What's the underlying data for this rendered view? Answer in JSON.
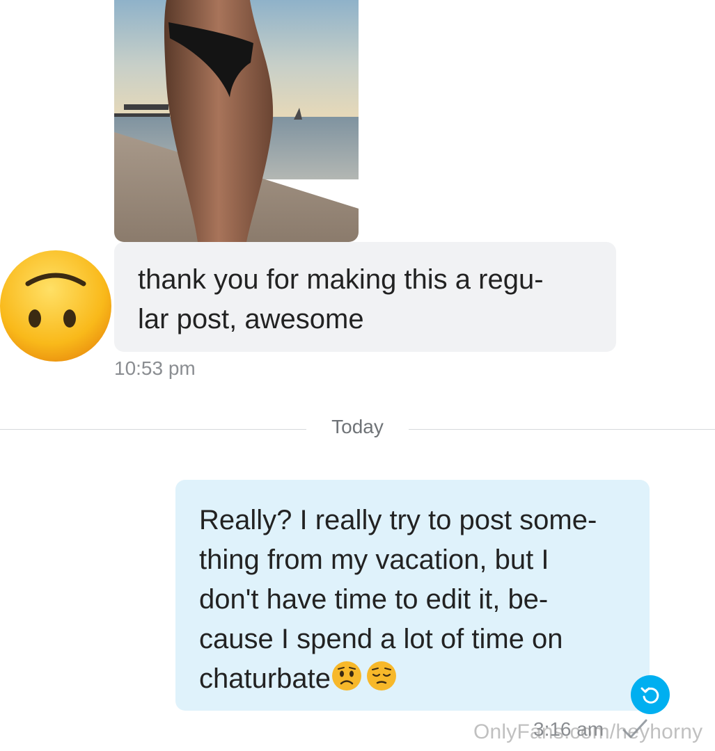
{
  "conversation": {
    "incoming": {
      "text_lines": [
        "thank you for making this a regu-",
        "lar post, awesome"
      ],
      "time": "10:53 pm"
    },
    "date_divider": "Today",
    "outgoing": {
      "text_lines": [
        "Really? I really try to post some-",
        "thing from my vacation, but I",
        "don't have time to edit it, be-",
        "cause I spend a lot of time on",
        "chaturbate"
      ],
      "time": "3:16 am"
    }
  },
  "watermark": "OnlyFans.com/heyhorny",
  "icons": {
    "avatar": "upside-down-face-icon",
    "reply": "reply-icon",
    "read": "check-icon",
    "emoji_1": "worried-face-icon",
    "emoji_2": "pensive-face-icon"
  },
  "colors": {
    "incoming_bubble": "#f1f2f4",
    "outgoing_bubble": "#dff2fb",
    "accent": "#00aff0"
  }
}
